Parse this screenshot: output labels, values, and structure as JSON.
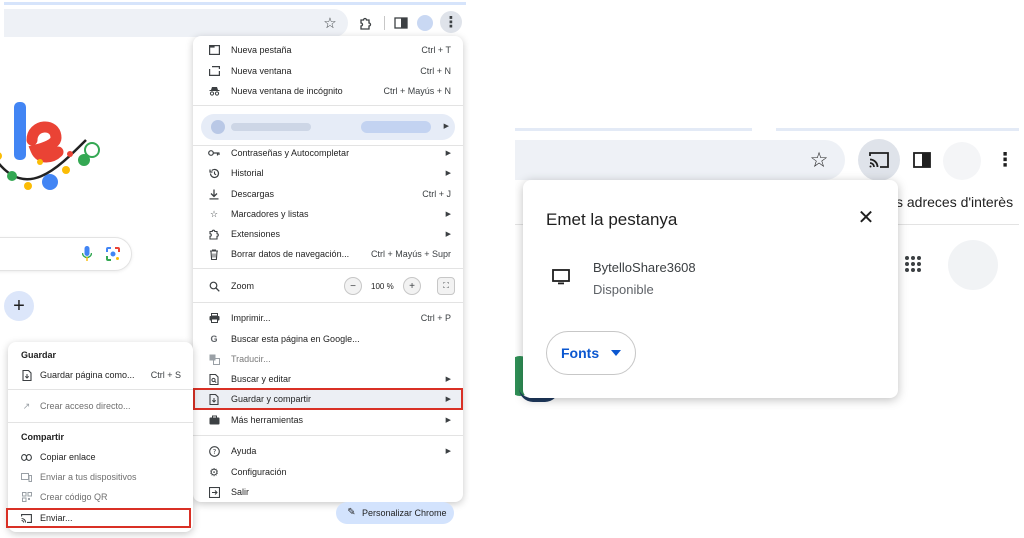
{
  "left": {
    "main_menu": {
      "items": [
        {
          "label": "Nueva pestaña",
          "shortcut": "Ctrl + T",
          "icon": "new-tab-icon"
        },
        {
          "label": "Nueva ventana",
          "shortcut": "Ctrl + N",
          "icon": "new-window-icon"
        },
        {
          "label": "Nueva ventana de incógnito",
          "shortcut": "Ctrl + Mayús + N",
          "icon": "incognito-icon"
        },
        {
          "label": "Contraseñas y Autocompletar",
          "icon": "key-icon"
        },
        {
          "label": "Historial",
          "icon": "history-icon"
        },
        {
          "label": "Descargas",
          "shortcut": "Ctrl + J",
          "icon": "download-icon"
        },
        {
          "label": "Marcadores y listas",
          "icon": "star-icon"
        },
        {
          "label": "Extensiones",
          "icon": "puzzle-icon"
        },
        {
          "label": "Borrar datos de navegación...",
          "shortcut": "Ctrl + Mayús + Supr",
          "icon": "trash-icon"
        },
        {
          "label": "Zoom",
          "icon": "zoom-icon"
        },
        {
          "label": "Imprimir...",
          "shortcut": "Ctrl + P",
          "icon": "print-icon"
        },
        {
          "label": "Buscar esta página en Google...",
          "icon": "google-icon"
        },
        {
          "label": "Traducir...",
          "icon": "translate-icon"
        },
        {
          "label": "Buscar y editar",
          "icon": "search-edit-icon"
        },
        {
          "label": "Guardar y compartir",
          "icon": "save-share-icon"
        },
        {
          "label": "Más herramientas",
          "icon": "toolbox-icon"
        },
        {
          "label": "Ayuda",
          "icon": "help-icon"
        },
        {
          "label": "Configuración",
          "icon": "gear-icon"
        },
        {
          "label": "Salir",
          "icon": "exit-icon"
        }
      ],
      "zoom": {
        "minus": "−",
        "value": "100 %",
        "plus": "+"
      }
    },
    "submenu": {
      "section1": "Guardar",
      "save_page": {
        "label": "Guardar página como...",
        "shortcut": "Ctrl + S"
      },
      "create_shortcut": "Crear acceso directo...",
      "section2": "Compartir",
      "copy_link": "Copiar enlace",
      "send_devices": "Enviar a tus dispositivos",
      "qr_code": "Crear código QR",
      "cast": "Enviar..."
    },
    "personalize_label": "Personalizar Chrome",
    "colors": {
      "highlight": "#d93025",
      "accent": "#0b57d0"
    }
  },
  "right": {
    "bookmarks_text": "s adreces d'interès",
    "cast_dialog": {
      "title": "Emet la pestanya",
      "device_name": "BytelloShare3608",
      "device_status": "Disponible",
      "sources_label": "Fonts"
    }
  }
}
